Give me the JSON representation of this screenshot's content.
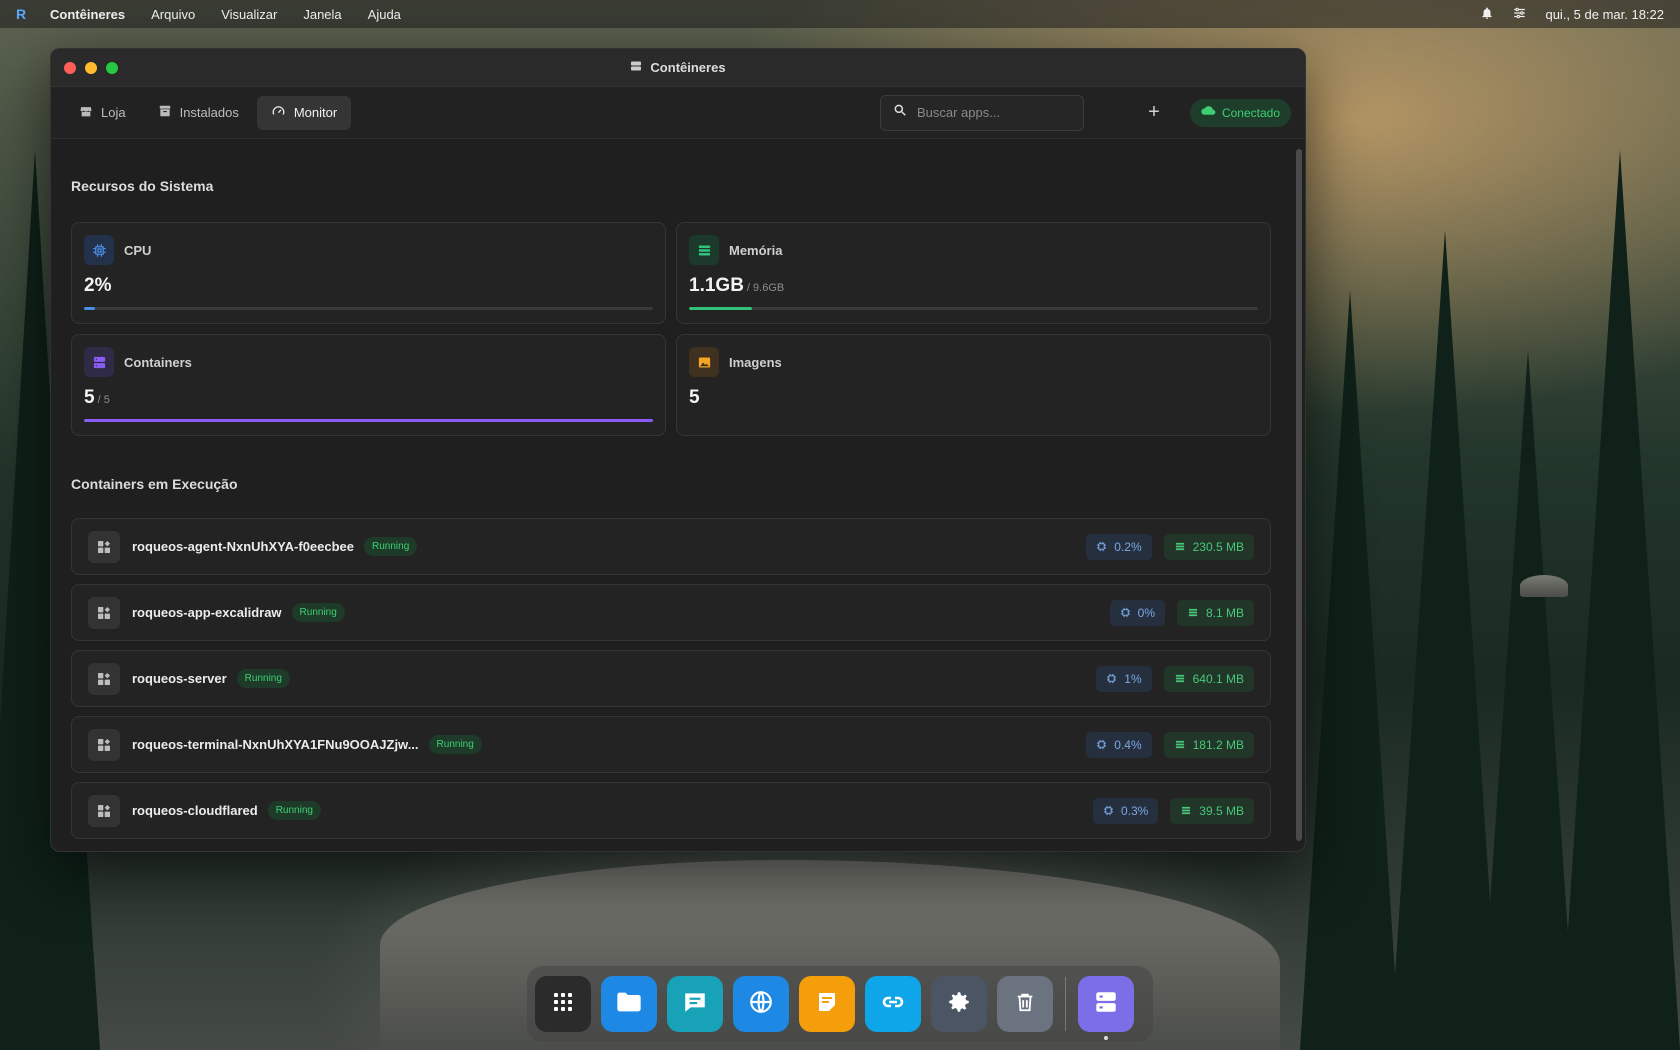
{
  "menubar": {
    "app_name": "Contêineres",
    "items": [
      "Arquivo",
      "Visualizar",
      "Janela",
      "Ajuda"
    ],
    "clock": "qui., 5 de mar. 18:22"
  },
  "window": {
    "title": "Contêineres",
    "tabs": [
      {
        "label": "Loja",
        "icon": "store-icon"
      },
      {
        "label": "Instalados",
        "icon": "archive-icon"
      },
      {
        "label": "Monitor",
        "icon": "gauge-icon"
      }
    ],
    "active_tab": "Monitor",
    "search_placeholder": "Buscar apps...",
    "connection_status": "Conectado"
  },
  "resources": {
    "title": "Recursos do Sistema",
    "cpu": {
      "label": "CPU",
      "value": "2%",
      "progress": 0.02,
      "color": "#4a8ee8"
    },
    "memory": {
      "label": "Memória",
      "value": "1.1GB",
      "total": "/ 9.6GB",
      "progress": 0.11,
      "color": "#31c27c"
    },
    "containers": {
      "label": "Containers",
      "value": "5",
      "total": "/ 5",
      "progress": 1.0,
      "color": "#8b5cf6"
    },
    "images": {
      "label": "Imagens",
      "value": "5"
    }
  },
  "running": {
    "title": "Containers em Execução",
    "rows": [
      {
        "name": "roqueos-agent-NxnUhXYA-f0eecbee",
        "status": "Running",
        "cpu": "0.2%",
        "mem": "230.5 MB"
      },
      {
        "name": "roqueos-app-excalidraw",
        "status": "Running",
        "cpu": "0%",
        "mem": "8.1 MB"
      },
      {
        "name": "roqueos-server",
        "status": "Running",
        "cpu": "1%",
        "mem": "640.1 MB"
      },
      {
        "name": "roqueos-terminal-NxnUhXYA1FNu9OOAJZjw...",
        "status": "Running",
        "cpu": "0.4%",
        "mem": "181.2 MB"
      },
      {
        "name": "roqueos-cloudflared",
        "status": "Running",
        "cpu": "0.3%",
        "mem": "39.5 MB"
      }
    ]
  },
  "dock": {
    "apps": [
      {
        "name": "app-grid-icon",
        "color": "#2b2b2b"
      },
      {
        "name": "files-icon",
        "color": "#1e88e5"
      },
      {
        "name": "messages-icon",
        "color": "#17a2b8"
      },
      {
        "name": "browser-icon",
        "color": "#1e88e5"
      },
      {
        "name": "notes-icon",
        "color": "#f59e0b"
      },
      {
        "name": "link-icon",
        "color": "#0ea5e9"
      },
      {
        "name": "settings-icon",
        "color": "#4b5563"
      },
      {
        "name": "trash-icon",
        "color": "#6b7280"
      },
      {
        "name": "containers-icon",
        "color": "#7c6ee6"
      }
    ]
  }
}
